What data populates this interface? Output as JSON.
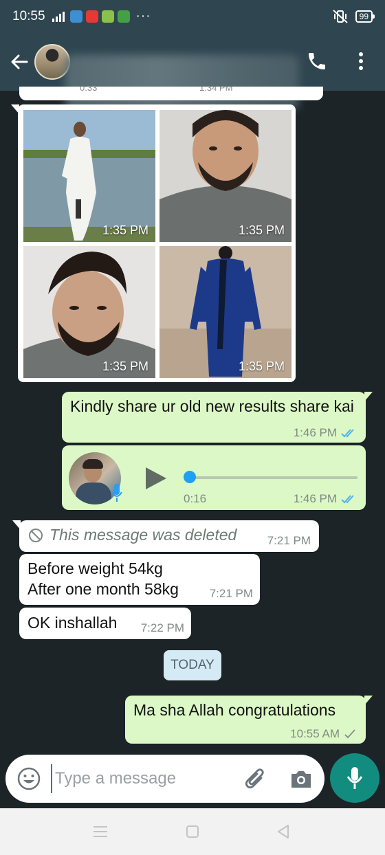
{
  "status_bar": {
    "time": "10:55",
    "more": "···",
    "battery": "99",
    "app_icon_colors": [
      "#3d8fd1",
      "#e53935",
      "#8bc34a",
      "#43a047"
    ]
  },
  "header": {
    "back_icon": "arrow-left-icon",
    "call_icon": "phone-icon",
    "menu_icon": "more-vert-icon"
  },
  "previous_message": {
    "meta_left": "0:33",
    "meta_right": "1:34 PM"
  },
  "media_grid": {
    "tiles": [
      {
        "time": "1:35 PM"
      },
      {
        "time": "1:35 PM"
      },
      {
        "time": "1:35 PM"
      },
      {
        "time": "1:35 PM"
      }
    ]
  },
  "messages": [
    {
      "direction": "out",
      "text": "Kindly share ur old new results share kai",
      "time": "1:46 PM",
      "status": "read"
    },
    {
      "direction": "out",
      "type": "voice",
      "duration": "0:16",
      "time": "1:46 PM",
      "status": "read"
    },
    {
      "direction": "in",
      "type": "deleted",
      "text": "This message was deleted",
      "time": "7:21 PM"
    },
    {
      "direction": "in",
      "text_line1": "Before weight 54kg",
      "text_line2": "After one month 58kg",
      "time": "7:21 PM"
    },
    {
      "direction": "in",
      "text": "OK inshallah",
      "time": "7:22 PM"
    },
    {
      "direction": "out",
      "text": "Ma sha Allah congratulations",
      "time": "10:55 AM",
      "status": "sent"
    }
  ],
  "date_divider": "TODAY",
  "composer": {
    "placeholder": "Type a message",
    "emoji_icon": "emoji-icon",
    "attach_icon": "paperclip-icon",
    "camera_icon": "camera-icon",
    "mic_icon": "mic-icon"
  },
  "colors": {
    "header": "#2f4650",
    "incoming_bubble": "#ffffff",
    "outgoing_bubble": "#dcf8c6",
    "read_ticks": "#4fb3e8",
    "accent": "#128c7e"
  }
}
